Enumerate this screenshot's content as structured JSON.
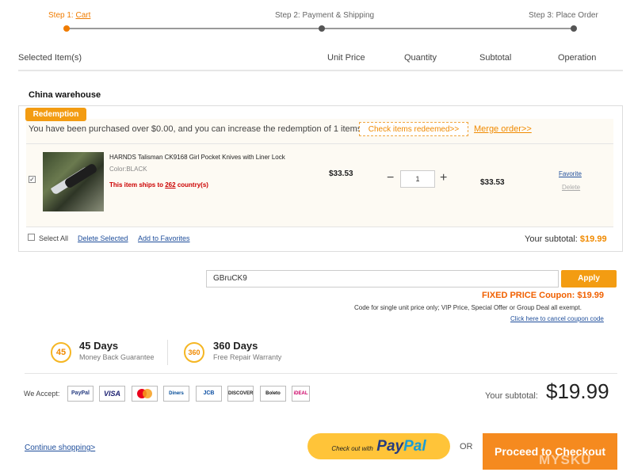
{
  "steps": {
    "step1_prefix": "Step 1: ",
    "step1_label": "Cart",
    "step2_label": "Step 2: Payment & Shipping",
    "step3_label": "Step 3: Place Order"
  },
  "table_headers": {
    "item": "Selected Item(s)",
    "unit_price": "Unit Price",
    "quantity": "Quantity",
    "subtotal": "Subtotal",
    "operation": "Operation"
  },
  "warehouse": "China warehouse",
  "redemption": {
    "badge": "Redemption",
    "notice": "You have been purchased over $0.00, and you can increase the redemption of 1 items",
    "check_button": "Check items redeemed>>",
    "merge_link": "Merge order>>"
  },
  "item": {
    "checked": true,
    "name": "HARNDS Talisman CK9168 Girl Pocket Knives with Liner Lock",
    "color": "Color:BLACK",
    "ship_prefix": "This item ships to ",
    "ship_count": "262",
    "ship_suffix": " country(s)",
    "unit_price": "$33.53",
    "quantity": "1",
    "qty_minus": "−",
    "qty_plus": "+",
    "subtotal": "$33.53",
    "favorite": "Favorite",
    "delete": "Delete"
  },
  "list_footer": {
    "select_all": "Select All",
    "delete_selected": "Delete Selected",
    "add_favorites": "Add to Favorites",
    "subtotal_label": "Your subtotal: ",
    "subtotal_value": "$19.99"
  },
  "coupon": {
    "code": "GBruCK9",
    "apply": "Apply",
    "fixed_price": "FIXED PRICE Coupon: $19.99",
    "note": "Code for single unit price only; VIP Price, Special Offer or Group Deal all exempt.",
    "cancel": "Click here to cancel coupon code"
  },
  "guarantees": [
    {
      "badge": "45",
      "title": "45 Days",
      "subtitle": "Money Back Guarantee"
    },
    {
      "badge": "360",
      "title": "360 Days",
      "subtitle": "Free Repair Warranty"
    }
  ],
  "payments": {
    "label": "We Accept:",
    "cards": [
      "PayPal",
      "VISA",
      "MC",
      "Diners",
      "JCB",
      "DISCOVER",
      "Boleto",
      "iDEAL"
    ]
  },
  "totals": {
    "label": "Your subtotal:",
    "value": "$19.99"
  },
  "actions": {
    "continue": "Continue shopping>",
    "paypal_small": "Check out with",
    "paypal_pay": "Pay",
    "paypal_pal": "Pal",
    "or": "OR",
    "checkout": "Proceed to Checkout",
    "watermark": "MYSKU"
  },
  "colors": {
    "accent": "#f39c12",
    "link": "#1f4e9b"
  }
}
